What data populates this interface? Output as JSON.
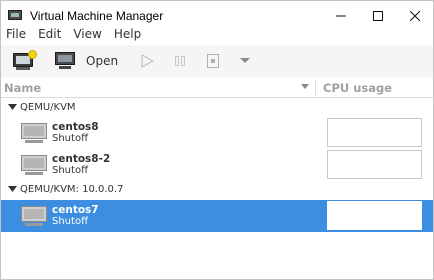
{
  "window": {
    "title": "Virtual Machine Manager",
    "controls": {
      "minimize": "–",
      "maximize": "☐",
      "close": "✕"
    }
  },
  "menubar": {
    "items": [
      "File",
      "Edit",
      "View",
      "Help"
    ]
  },
  "toolbar": {
    "new_vm_icon": "new-vm-icon",
    "open_label": "Open",
    "run_icon": "play-icon",
    "pause_icon": "pause-icon",
    "shutdown_icon": "stop-icon",
    "shutdown_menu_icon": "chevron-down-icon"
  },
  "columns": {
    "name": "Name",
    "cpu": "CPU usage"
  },
  "connections": [
    {
      "label": "QEMU/KVM",
      "vms": [
        {
          "name": "centos8",
          "status": "Shutoff",
          "selected": false
        },
        {
          "name": "centos8-2",
          "status": "Shutoff",
          "selected": false
        }
      ]
    },
    {
      "label": "QEMU/KVM: 10.0.0.7",
      "vms": [
        {
          "name": "centos7",
          "status": "Shutoff",
          "selected": true
        }
      ]
    }
  ],
  "colors": {
    "selection": "#3d8ee0",
    "header_text": "#a0a0a0",
    "icon_accent": "#f5d40f"
  }
}
